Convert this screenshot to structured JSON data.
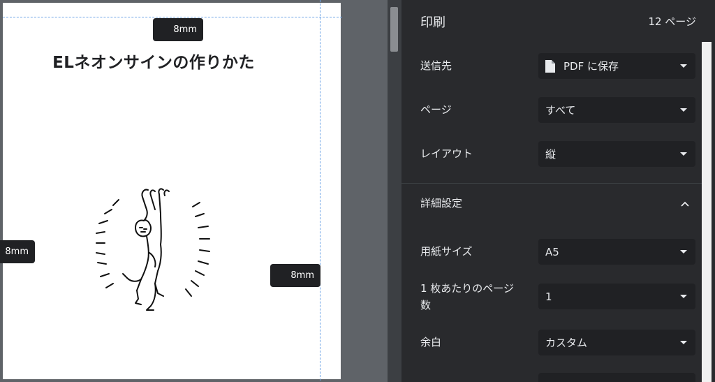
{
  "preview": {
    "title": "ELネオンサインの作りかた",
    "margins": {
      "top": "8mm",
      "left": "8mm",
      "right": "8mm"
    }
  },
  "header": {
    "title": "印刷",
    "page_count": "12 ページ"
  },
  "settings": {
    "destination": {
      "label": "送信先",
      "value": "PDF に保存",
      "icon": "file-icon"
    },
    "pages": {
      "label": "ページ",
      "value": "すべて"
    },
    "layout": {
      "label": "レイアウト",
      "value": "縦"
    },
    "advanced": {
      "label": "詳細設定",
      "icon": "chevron-up-icon"
    },
    "paper_size": {
      "label": "用紙サイズ",
      "value": "A5"
    },
    "pages_per_sheet": {
      "label_line1": "1 枚あたりのページ",
      "label_line2": "数",
      "value": "1"
    },
    "margins": {
      "label": "余白",
      "value": "カスタム"
    }
  },
  "colors": {
    "panel": "#292a2d",
    "select": "#202124",
    "text": "#e8eaed",
    "guide": "#6ea4e6"
  }
}
